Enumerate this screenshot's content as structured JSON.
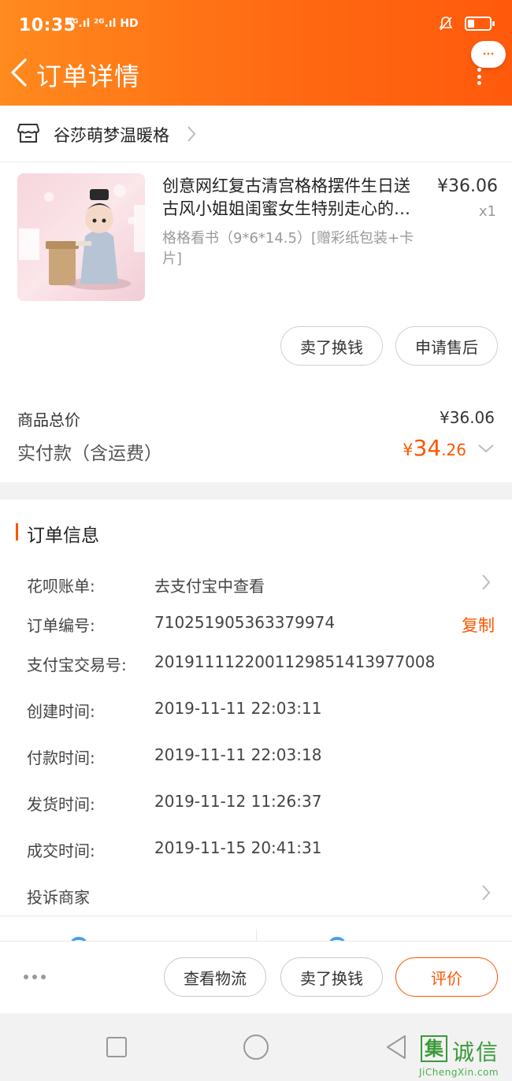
{
  "status_bar": {
    "time": "10:35",
    "signal_text": "⁴ᴳ.ıl ²ᴳ.ıl HD",
    "battery_level": 0.3
  },
  "nav": {
    "title": "订单详情",
    "more_label": "···"
  },
  "shop": {
    "name": "谷莎萌梦温暖格"
  },
  "product": {
    "title": "创意网红复古清宫格格摆件生日送古风小姐姐闺蜜女生特别走心的礼物",
    "price": "¥36.06",
    "quantity": "x1",
    "sku": "格格看书（9*6*14.5）[赠彩纸包装+卡片]",
    "actions": [
      "卖了换钱",
      "申请售后"
    ]
  },
  "summary": {
    "goods_total_label": "商品总价",
    "goods_total_value": "¥36.06",
    "paid_label": "实付款（含运费）",
    "paid_currency": "¥",
    "paid_integer": "34",
    "paid_decimal": ".26"
  },
  "order_info": {
    "title": "订单信息",
    "rows": [
      {
        "label": "花呗账单:",
        "value": "去支付宝中查看"
      },
      {
        "label": "订单编号:",
        "value": "710251905363379974"
      },
      {
        "label": "支付宝交易号:",
        "value": "2019111122001129851413977008"
      },
      {
        "label": "创建时间:",
        "value": "2019-11-11 22:03:11"
      },
      {
        "label": "付款时间:",
        "value": "2019-11-11 22:03:18"
      },
      {
        "label": "发货时间:",
        "value": "2019-11-12 11:26:37"
      },
      {
        "label": "成交时间:",
        "value": "2019-11-15 20:41:31"
      },
      {
        "label": "投诉商家",
        "value": ""
      }
    ],
    "copy_label": "复制"
  },
  "action_bar": {
    "buttons": [
      "查看物流",
      "卖了换钱",
      "评价"
    ]
  },
  "watermark": {
    "logo_char": "集",
    "text": "诚信",
    "url": "JiChengXin.com"
  },
  "colors": {
    "accent": "#ff5500",
    "header_start": "#ff8a1e",
    "header_end": "#ff5a0c",
    "link_blue": "#3aa0f0"
  }
}
